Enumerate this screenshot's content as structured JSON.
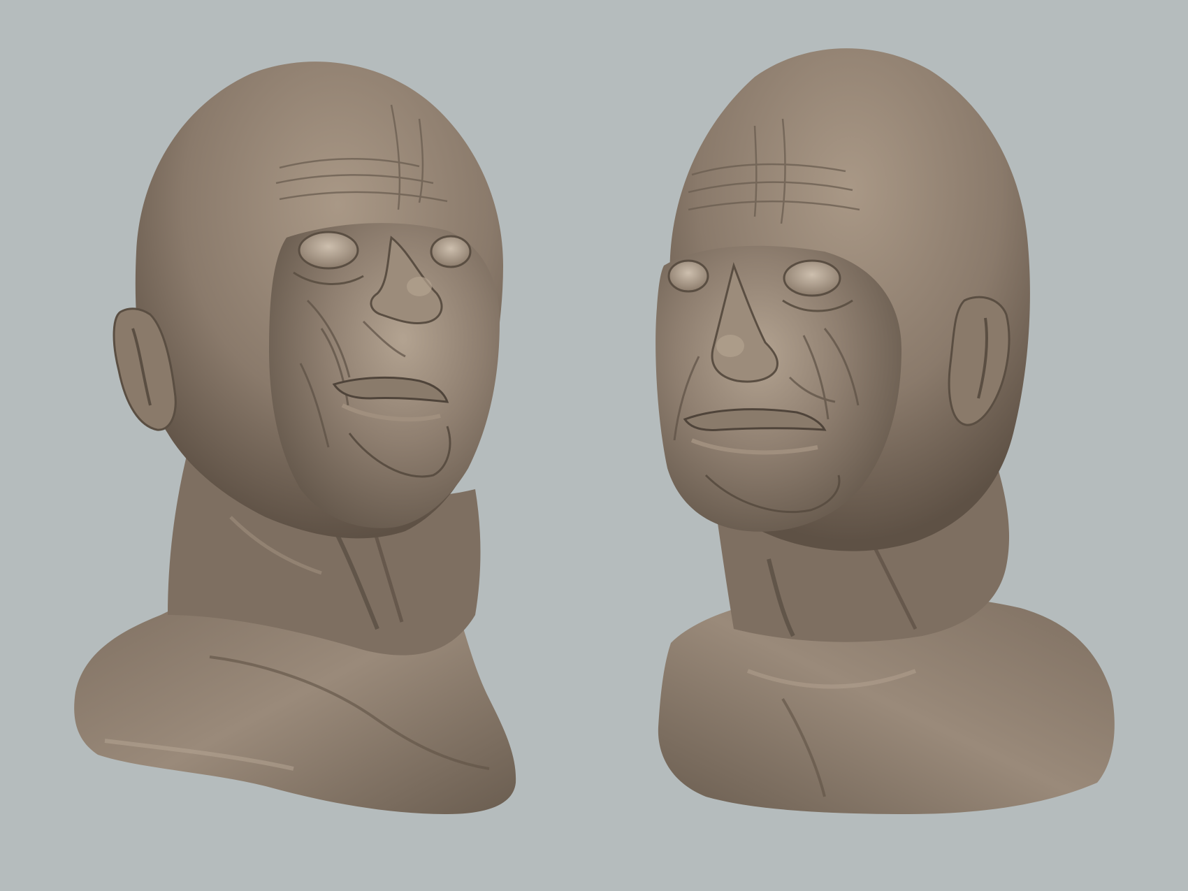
{
  "scene": {
    "background_color": "#b5bcbd",
    "clay_color": "#8a7b6d",
    "clay_highlight": "#c2b3a3",
    "clay_shadow": "#4f4439",
    "views": [
      {
        "name": "head-three-quarter-left",
        "facing": "right",
        "tilt": "looking up"
      },
      {
        "name": "head-three-quarter-right",
        "facing": "left",
        "tilt": "level"
      }
    ]
  }
}
